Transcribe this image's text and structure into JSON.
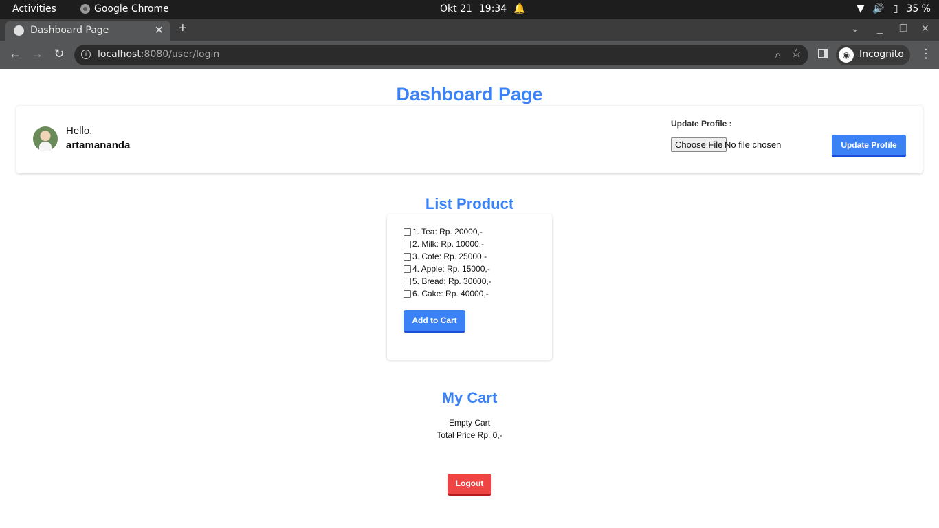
{
  "system_bar": {
    "activities": "Activities",
    "app_name": "Google Chrome",
    "date": "Okt 21",
    "time": "19:34",
    "battery": "35 %"
  },
  "browser": {
    "tab_title": "Dashboard Page",
    "url_host": "localhost",
    "url_rest": ":8080/user/login",
    "profile_label": "Incognito"
  },
  "page": {
    "title": "Dashboard Page",
    "greeting": "Hello,",
    "username": "artamananda",
    "update_profile_label": "Update Profile :",
    "choose_file_label": "Choose File",
    "no_file_text": "No file chosen",
    "update_profile_button": "Update Profile",
    "list_title": "List Product",
    "products": [
      "1. Tea: Rp. 20000,-",
      "2. Milk: Rp. 10000,-",
      "3. Cofe: Rp. 25000,-",
      "4. Apple: Rp. 15000,-",
      "5. Bread: Rp. 30000,-",
      "6. Cake: Rp. 40000,-"
    ],
    "add_to_cart_button": "Add to Cart",
    "cart_title": "My Cart",
    "cart_empty": "Empty Cart",
    "cart_total": "Total Price Rp. 0,-",
    "logout_button": "Logout"
  }
}
